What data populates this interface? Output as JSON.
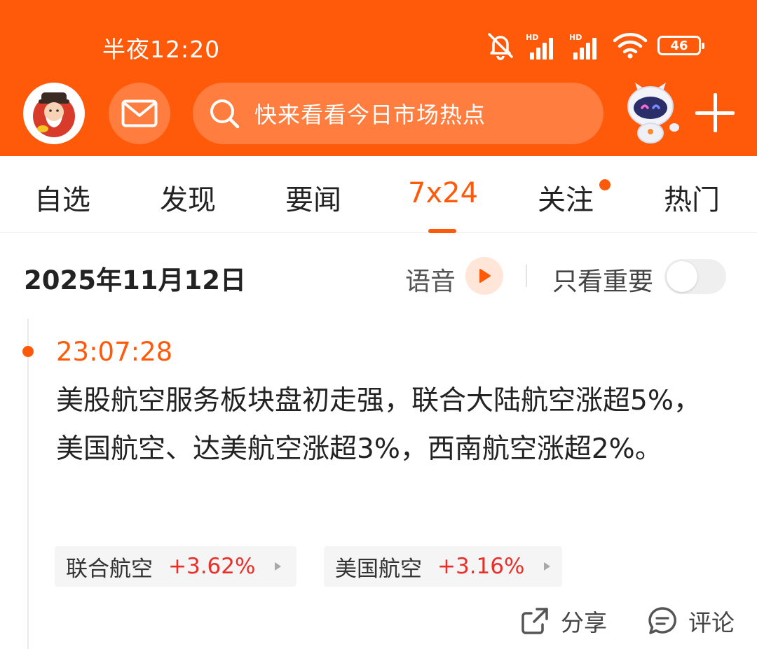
{
  "status_bar": {
    "time": "半夜12:20",
    "hd_label": "HD",
    "battery": "46"
  },
  "header": {
    "search_placeholder": "快来看看今日市场热点",
    "icons": [
      "avatar",
      "mail-icon",
      "search-icon",
      "robot-assistant-icon",
      "plus-icon"
    ],
    "accent_color": "#ff5a0a"
  },
  "tabs": [
    {
      "label": "自选"
    },
    {
      "label": "发现"
    },
    {
      "label": "要闻"
    },
    {
      "label": "7x24",
      "active": true
    },
    {
      "label": "关注",
      "badge": true
    },
    {
      "label": "热门"
    }
  ],
  "date_row": {
    "date": "2025年11月12日",
    "voice_label": "语音",
    "important_only_label": "只看重要",
    "important_only_on": false
  },
  "news": [
    {
      "time": "23:07:28",
      "text": "美股航空服务板块盘初走强，联合大陆航空涨超5%，美国航空、达美航空涨超3%，西南航空涨超2%。",
      "stocks": [
        {
          "name": "联合航空",
          "change": "+3.62%"
        },
        {
          "name": "美国航空",
          "change": "+3.16%"
        }
      ],
      "share_label": "分享",
      "comment_label": "评论"
    }
  ]
}
